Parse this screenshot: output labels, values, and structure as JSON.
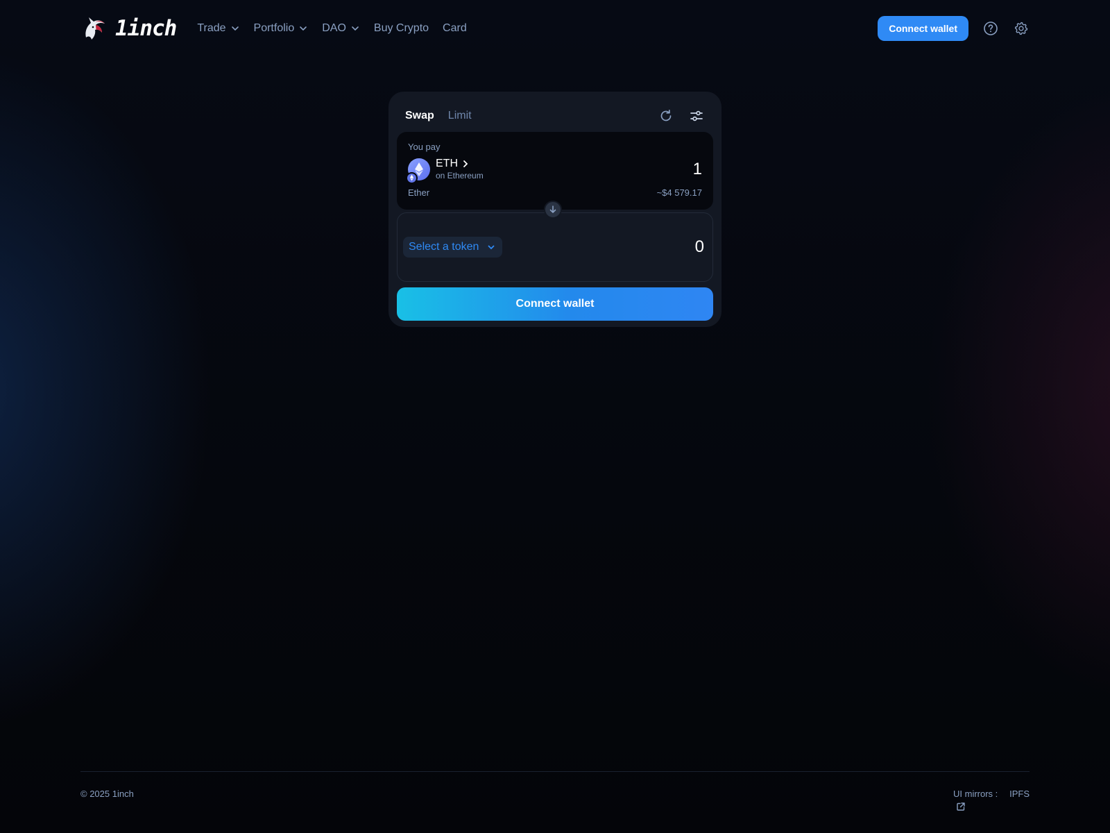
{
  "header": {
    "logo_text": "1inch",
    "nav": [
      {
        "label": "Trade",
        "has_dropdown": true
      },
      {
        "label": "Portfolio",
        "has_dropdown": true
      },
      {
        "label": "DAO",
        "has_dropdown": true
      },
      {
        "label": "Buy Crypto",
        "has_dropdown": false
      },
      {
        "label": "Card",
        "has_dropdown": false
      }
    ],
    "connect_label": "Connect wallet",
    "help_icon": "help-circle-icon",
    "settings_icon": "gear-icon"
  },
  "swap": {
    "tabs": [
      {
        "label": "Swap",
        "active": true
      },
      {
        "label": "Limit",
        "active": false
      }
    ],
    "pay": {
      "label": "You pay",
      "token_symbol": "ETH",
      "token_chain": "on Ethereum",
      "token_name": "Ether",
      "amount": "1",
      "usd_value": "~$4 579.17"
    },
    "receive": {
      "select_label": "Select a token",
      "amount": "0"
    },
    "connect_label": "Connect wallet"
  },
  "footer": {
    "copyright": "© 2025 1inch",
    "mirrors_label": "UI mirrors :",
    "mirrors_link": "IPFS"
  },
  "colors": {
    "accent": "#2f8af5",
    "muted_text": "#8aa0c2",
    "card_bg": "#131823"
  }
}
